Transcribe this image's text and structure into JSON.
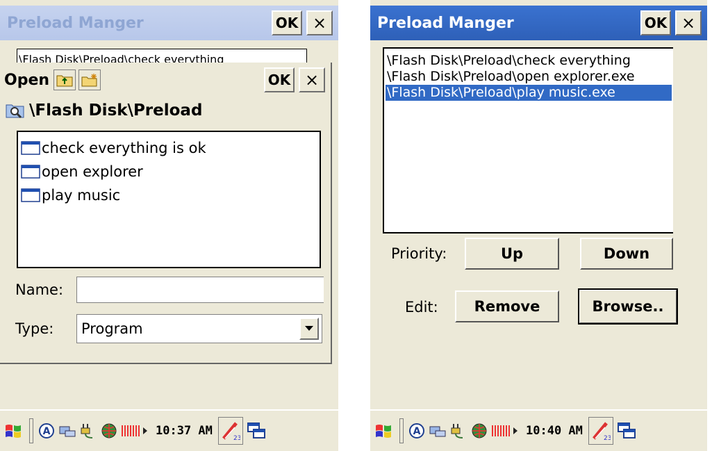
{
  "left": {
    "bg_title": "Preload Manger",
    "bg_ok": "OK",
    "close": "×",
    "bg_path": "\\Flash Disk\\Preload\\check everything",
    "open": {
      "label": "Open",
      "ok": "OK",
      "path": "\\Flash Disk\\Preload",
      "files": [
        "check everything is ok",
        "open explorer",
        "play music"
      ],
      "name_label": "Name:",
      "name_value": "",
      "type_label": "Type:",
      "type_value": "Program"
    },
    "taskbar": {
      "time": "10:37 AM"
    }
  },
  "right": {
    "title": "Preload Manger",
    "ok": "OK",
    "close": "×",
    "items": [
      "\\Flash Disk\\Preload\\check everything",
      "\\Flash Disk\\Preload\\open explorer.exe",
      "\\Flash Disk\\Preload\\play music.exe"
    ],
    "selected_index": 2,
    "priority_label": "Priority:",
    "up": "Up",
    "down": "Down",
    "edit_label": "Edit:",
    "remove": "Remove",
    "browse": "Browse..",
    "taskbar": {
      "time": "10:40 AM"
    }
  },
  "colors": {
    "titlebar_active": "#2e60b8",
    "titlebar_inactive": "#c6d3ef",
    "selection": "#316ac5",
    "window_face": "#ece9d8"
  },
  "icons": [
    "windows-flag-icon",
    "keyboard-icon",
    "input-method-icon",
    "network-icon",
    "power-plug-icon",
    "globe-icon",
    "signal-icon",
    "volume-icon",
    "desktop-switch-icon"
  ]
}
